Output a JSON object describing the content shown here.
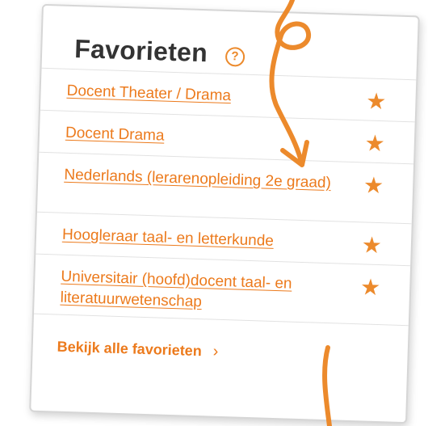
{
  "widget": {
    "title": "Favorieten",
    "help_icon": "?",
    "items": [
      {
        "label": "Docent Theater / Drama",
        "icon": "star-icon"
      },
      {
        "label": "Docent Drama",
        "icon": "star-icon"
      },
      {
        "label": "Nederlands (lerarenopleiding 2e graad)",
        "icon": "star-icon"
      },
      {
        "label": "Hoogleraar taal- en letterkunde",
        "icon": "star-icon"
      },
      {
        "label": "Universitair (hoofd)docent taal- en literatuurwetenschap",
        "icon": "star-icon"
      }
    ],
    "star_glyph": "★",
    "footer_link": "Bekijk alle favorieten",
    "footer_chevron": "›"
  },
  "colors": {
    "accent": "#ec7a1c",
    "title": "#333333",
    "divider": "#e2e2e2"
  }
}
